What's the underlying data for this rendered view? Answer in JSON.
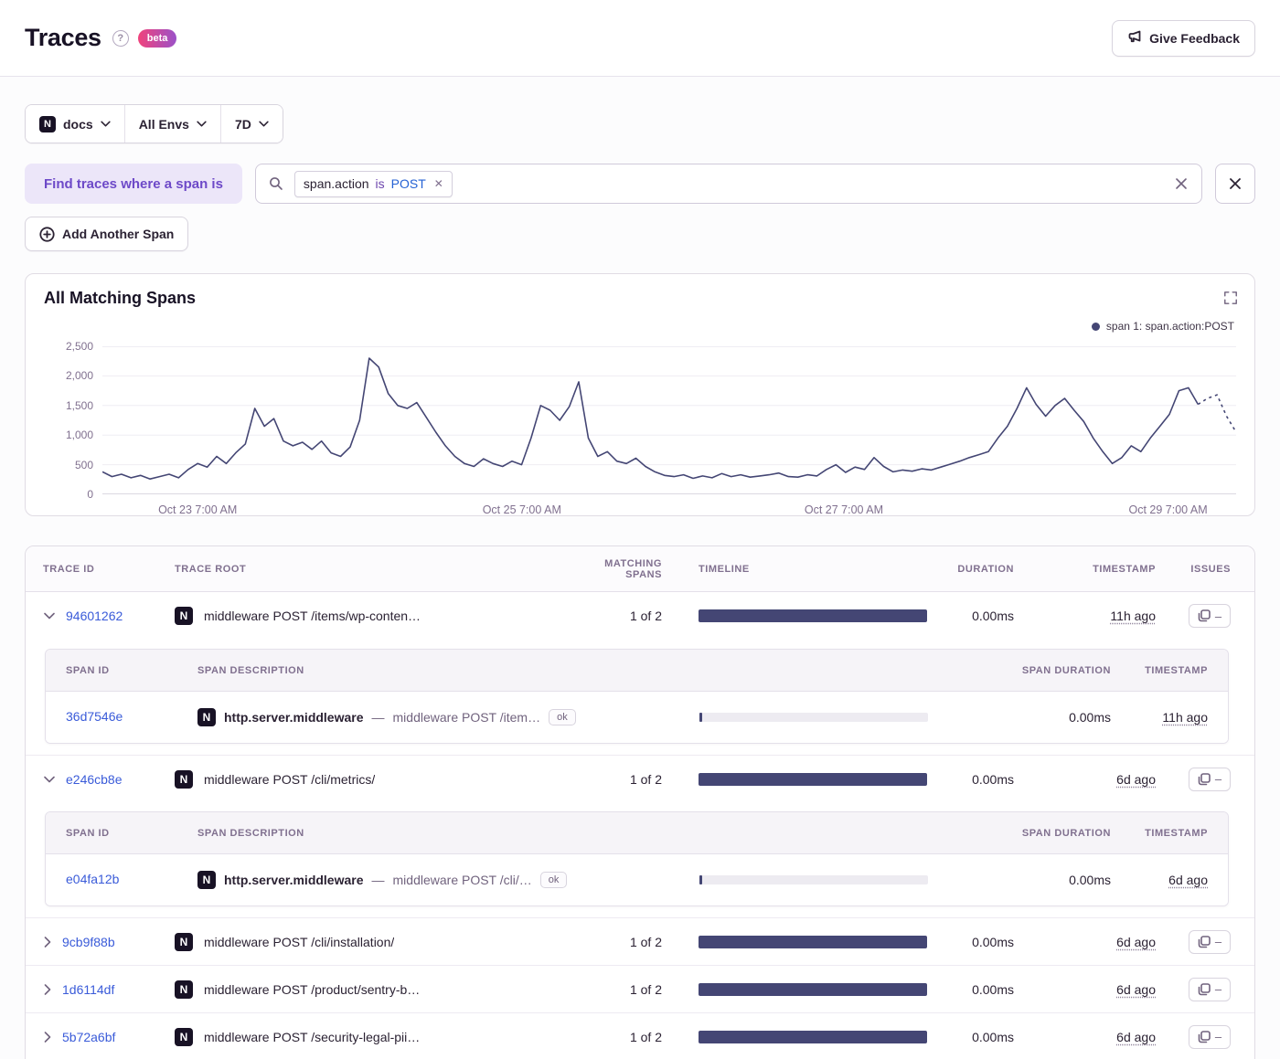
{
  "colors": {
    "accent": "#6d49c8",
    "link": "#3a5bd9",
    "bar": "#444674",
    "beta_from": "#f0437c",
    "beta_to": "#9b51c8"
  },
  "header": {
    "title": "Traces",
    "help": "?",
    "beta": "beta",
    "feedback": "Give Feedback"
  },
  "filters": {
    "project": "docs",
    "project_icon": "N",
    "env": "All Envs",
    "period": "7D"
  },
  "search": {
    "where_label": "Find traces where a span is",
    "token_key": "span.action",
    "token_op": "is",
    "token_value": "POST",
    "add_span": "Add Another Span"
  },
  "chart_data": {
    "type": "line",
    "title": "All Matching Spans",
    "legend": [
      {
        "label": "span 1: span.action:POST",
        "color": "#444674"
      }
    ],
    "ylim": [
      0,
      2500
    ],
    "yticks": [
      "2,500",
      "2,000",
      "1,500",
      "1,000",
      "500",
      "0"
    ],
    "xticks": [
      "Oct 23 7:00 AM",
      "Oct 25 7:00 AM",
      "Oct 27 7:00 AM",
      "Oct 29 7:00 AM"
    ],
    "grid": true,
    "legend_position": "top-right",
    "series": [
      {
        "name": "span 1: span.action:POST",
        "color": "#444674",
        "values": [
          380,
          300,
          340,
          280,
          320,
          260,
          300,
          340,
          280,
          420,
          520,
          460,
          640,
          520,
          700,
          850,
          1450,
          1150,
          1280,
          900,
          820,
          880,
          760,
          900,
          700,
          640,
          800,
          1250,
          2300,
          2150,
          1700,
          1500,
          1450,
          1550,
          1300,
          1050,
          820,
          640,
          520,
          470,
          600,
          520,
          470,
          560,
          500,
          950,
          1500,
          1420,
          1250,
          1480,
          1900,
          950,
          640,
          720,
          560,
          520,
          610,
          470,
          380,
          320,
          300,
          330,
          270,
          310,
          280,
          350,
          300,
          330,
          290,
          310,
          330,
          360,
          300,
          290,
          330,
          310,
          420,
          500,
          370,
          460,
          420,
          620,
          470,
          380,
          410,
          390,
          430,
          410,
          460,
          510,
          560,
          620,
          670,
          720,
          950,
          1150,
          1450,
          1800,
          1520,
          1320,
          1500,
          1620,
          1420,
          1230,
          950,
          720,
          520,
          620,
          820,
          720,
          950,
          1150,
          1350,
          1750,
          1800,
          1520,
          1620,
          1680,
          1320,
          1050
        ]
      }
    ]
  },
  "table": {
    "columns": {
      "trace_id": "Trace ID",
      "trace_root": "Trace Root",
      "matching": "Matching Spans",
      "timeline": "Timeline",
      "duration": "Duration",
      "timestamp": "Timestamp",
      "issues": "Issues"
    },
    "span_columns": {
      "span_id": "Span ID",
      "span_description": "Span Description",
      "span_duration": "Span Duration",
      "timestamp": "Timestamp"
    },
    "rows": [
      {
        "id": "94601262",
        "platform": "N",
        "root": "middleware POST /items/wp-conten…",
        "matching": "1 of 2",
        "duration": "0.00ms",
        "timestamp": "11h ago",
        "spans": [
          {
            "id": "36d7546e",
            "platform": "N",
            "op": "http.server.middleware",
            "sep": "—",
            "description": "middleware POST /item…",
            "status": "ok",
            "duration": "0.00ms",
            "timestamp": "11h ago"
          }
        ]
      },
      {
        "id": "e246cb8e",
        "platform": "N",
        "root": "middleware POST /cli/metrics/",
        "matching": "1 of 2",
        "duration": "0.00ms",
        "timestamp": "6d ago",
        "spans": [
          {
            "id": "e04fa12b",
            "platform": "N",
            "op": "http.server.middleware",
            "sep": "—",
            "description": "middleware POST /cli/…",
            "status": "ok",
            "duration": "0.00ms",
            "timestamp": "6d ago"
          }
        ]
      },
      {
        "id": "9cb9f88b",
        "platform": "N",
        "root": "middleware POST /cli/installation/",
        "matching": "1 of 2",
        "duration": "0.00ms",
        "timestamp": "6d ago"
      },
      {
        "id": "1d6114df",
        "platform": "N",
        "root": "middleware POST /product/sentry-b…",
        "matching": "1 of 2",
        "duration": "0.00ms",
        "timestamp": "6d ago"
      },
      {
        "id": "5b72a6bf",
        "platform": "N",
        "root": "middleware POST /security-legal-pii…",
        "matching": "1 of 2",
        "duration": "0.00ms",
        "timestamp": "6d ago"
      }
    ]
  }
}
